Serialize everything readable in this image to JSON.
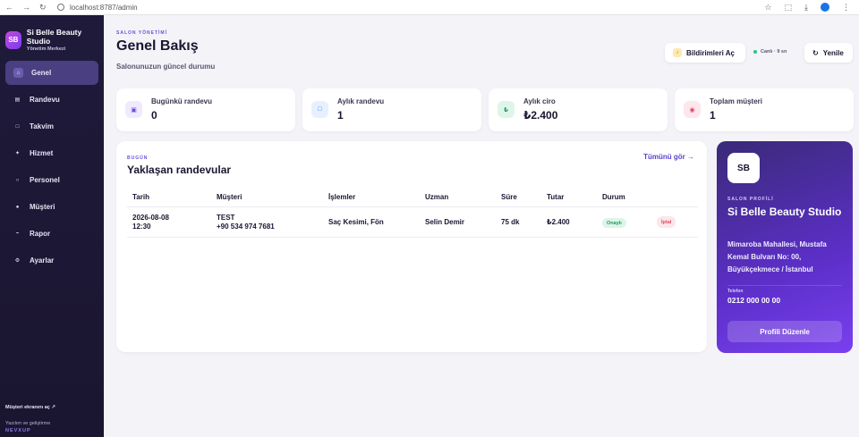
{
  "browser": {
    "url": "localhost:8787/admin"
  },
  "sidebar": {
    "logo": "SB",
    "brand_name": "Si Belle Beauty Studio",
    "brand_sub": "Yönetim Merkezi",
    "items": [
      {
        "label": "Genel",
        "icon": "⌂",
        "active": true
      },
      {
        "label": "Randevu",
        "icon": "▤"
      },
      {
        "label": "Takvim",
        "icon": "□"
      },
      {
        "label": "Hizmet",
        "icon": "✦"
      },
      {
        "label": "Personel",
        "icon": "○"
      },
      {
        "label": "Müşteri",
        "icon": "●"
      },
      {
        "label": "Rapor",
        "icon": "~"
      },
      {
        "label": "Ayarlar",
        "icon": "⚙"
      }
    ],
    "customer_screen_link": "Müşteri ekranını aç ↗",
    "credit_line": "Yazılım ve geliştirme",
    "credit_brand": "NEVXUP"
  },
  "header": {
    "eyebrow": "SALON YÖNETİMİ",
    "title": "Genel Bakış",
    "subtitle": "Salonunuzun güncel durumu",
    "notif_button": "Bildirimleri Aç",
    "live_text": "Canlı · 9 sn",
    "refresh_button": "Yenile"
  },
  "stats": [
    {
      "label": "Bugünkü randevu",
      "value": "0",
      "icon": "▣",
      "bg": "#efeafe",
      "fg": "#6a4fd8"
    },
    {
      "label": "Aylık randevu",
      "value": "1",
      "icon": "□",
      "bg": "#e6f0fe",
      "fg": "#3a7bd8"
    },
    {
      "label": "Aylık ciro",
      "value": "₺2.400",
      "icon": "₺",
      "bg": "#dff5ea",
      "fg": "#1e9a5f"
    },
    {
      "label": "Toplam müşteri",
      "value": "1",
      "icon": "◉",
      "bg": "#fde6ec",
      "fg": "#d84b66"
    }
  ],
  "appointments": {
    "eyebrow": "BUGÜN",
    "title": "Yaklaşan randevular",
    "see_all": "Tümünü gör →",
    "columns": [
      "Tarih",
      "Müşteri",
      "İşlemler",
      "Uzman",
      "Süre",
      "Tutar",
      "Durum"
    ],
    "rows": [
      {
        "date": "2026-08-08",
        "time": "12:30",
        "customer": "TEST",
        "phone": "+90 534 974 7681",
        "services": "Saç Kesimi, Fön",
        "expert": "Selin Demir",
        "duration": "75 dk",
        "amount": "₺2.400",
        "status": "Onaylı",
        "action": "İptal"
      }
    ]
  },
  "profile": {
    "avatar": "SB",
    "eyebrow": "SALON PROFİLİ",
    "name": "Si Belle Beauty Studio",
    "address": "Mimaroba Mahallesi, Mustafa Kemal Bulvarı No: 00, Büyükçekmece / İstanbul",
    "phone_label": "Telefon",
    "phone": "0212 000 00 00",
    "edit_button": "Profili Düzenle"
  }
}
